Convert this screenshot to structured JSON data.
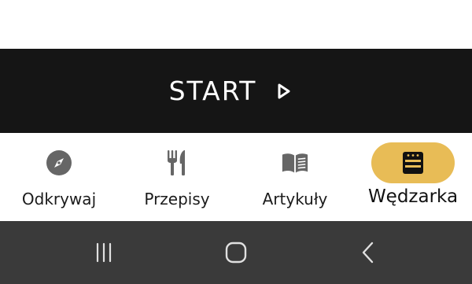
{
  "start_bar": {
    "label": "START",
    "icon": "play-icon"
  },
  "bottom_nav": {
    "items": [
      {
        "label": "Odkrywaj",
        "icon": "compass-icon",
        "active": false
      },
      {
        "label": "Przepisy",
        "icon": "fork-knife-icon",
        "active": false
      },
      {
        "label": "Artykuły",
        "icon": "book-icon",
        "active": false
      },
      {
        "label": "Wędzarka",
        "icon": "smoker-icon",
        "active": true
      }
    ]
  },
  "system_nav": {
    "buttons": [
      "recent-apps-icon",
      "home-icon",
      "back-icon"
    ]
  },
  "colors": {
    "start_bg": "#151515",
    "accent": "#e8bc56",
    "icon_gray": "#6b6b6b",
    "system_bar": "#3a3a3a"
  }
}
